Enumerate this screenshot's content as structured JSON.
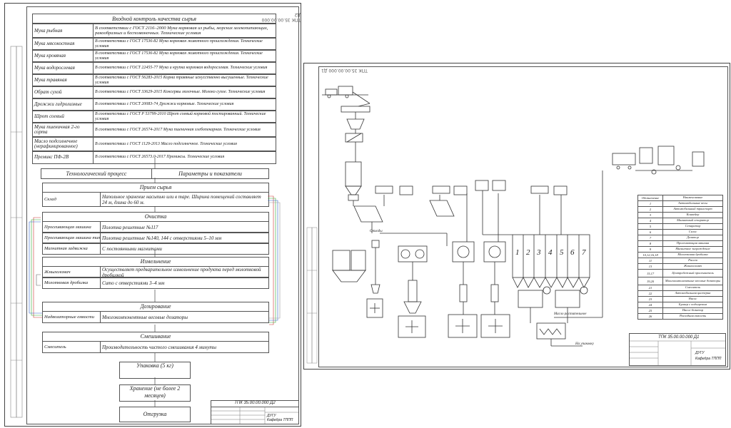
{
  "left_sheet": {
    "stamp": "ТПК 35.00.00.000 Д2",
    "quality_table": {
      "title": "Входной контроль качества сырья",
      "rows": [
        {
          "name": "Мука рыбная",
          "desc": "В соответствии с ГОСТ 2116–2000 Мука кормовая из рыбы, морских млекопитающих, ракообразных и беспозвоночных. Технические условия"
        },
        {
          "name": "Мука мясокостная",
          "desc": "В соответствии с ГОСТ 17536-82 Мука кормовая животного происхождения. Технические условия"
        },
        {
          "name": "Мука кровяная",
          "desc": "В соответствии с ГОСТ 17536-82 Мука кормовая животного происхождения. Технические условия"
        },
        {
          "name": "Мука водорослевая",
          "desc": "В соответствии с ГОСТ 22455-77 Мука и крупка кормовая водорослевая. Технические условия"
        },
        {
          "name": "Мука травяная",
          "desc": "В соответствии с ГОСТ 56283-2015 Корма травяные искусственно высушенные. Технические условия"
        },
        {
          "name": "Обрат сухой",
          "desc": "В соответствии с ГОСТ 33629-2015 Консервы молочные. Молоко сухое. Технические условия"
        },
        {
          "name": "Дрожжи гидролизные",
          "desc": "В соответствии с ГОСТ 20083-74 Дрожжи кормовые. Технические условия"
        },
        {
          "name": "Шрот соевый",
          "desc": "В соответствии с ГОСТ Р 53799-2010 Шрот соевый кормовой тостированный. Технические условия"
        },
        {
          "name": "Мука пшеничная 2-го сорта",
          "desc": "В соответствии с ГОСТ 26574-2017 Мука пшеничная хлебопекарная. Технические условия"
        },
        {
          "name": "Масло подсолнечное (нерафинированное)",
          "desc": "В соответствии с ГОСТ 1129-2013 Масло подсолнечное. Технические условия"
        },
        {
          "name": "Премикс ПФ-2В",
          "desc": "В соответствии с ГОСТ 26573.0-2017 Премиксы. Технические условия"
        }
      ]
    },
    "process_header": {
      "col1": "Технологический процесс",
      "col2": "Параметры и показатели"
    },
    "stages": [
      {
        "title": "Прием сырья",
        "rows": [
          {
            "name": "Склад",
            "desc": "Напольное хранение насыпью или в таре. Ширина помещений составляет 24 м, длина до 60 м."
          }
        ]
      },
      {
        "title": "Очистка",
        "rows": [
          {
            "name": "Просеивающая машина",
            "desc": "Полотна решетные №117"
          },
          {
            "name": "Просеивающая машина типа А1-БЦП",
            "desc": "Полотна решетные №140, 144 с отверстиями 5–10 мм"
          },
          {
            "name": "Магнитная задвижка",
            "desc": "С постоянными магнитами"
          }
        ]
      },
      {
        "title": "Измельчение",
        "rows": [
          {
            "name": "Жмыхоломач",
            "desc": "Осуществляет предварительное измельчение продукта перед молотковой дробилкой"
          },
          {
            "name": "Молотковая дробилка",
            "desc": "Сито с отверстиями 3–4 мм"
          }
        ]
      },
      {
        "title": "Дозирование",
        "rows": [
          {
            "name": "Надвозаторные емкости",
            "desc": "Многокомпонентные весовые дозаторы"
          }
        ]
      },
      {
        "title": "Смешивание",
        "rows": [
          {
            "name": "Смеситель",
            "desc": "Производительность чистого смешивания 4 минуты"
          }
        ]
      }
    ],
    "final_steps": [
      "Упаковка (5 кг)",
      "Хранение (не более 2 месяцев)",
      "Отгрузка"
    ],
    "title_block": {
      "code": "ТПК 35.00.00.000 Д2",
      "org": "Кафедра ТППП",
      "lit": "ДУГУ"
    }
  },
  "right_sheet": {
    "stamp": "ТПК 35.00.00.000 Д1",
    "title_block": {
      "code": "ТПК 35.00.00.000 Д1",
      "org": "Кафедра ТППП",
      "lit": "ДУГУ"
    },
    "bins": [
      "1",
      "2",
      "3",
      "4",
      "5",
      "6",
      "7"
    ],
    "flow_labels": {
      "waste": "Отходы",
      "oil": "Масло растительное",
      "to_packing": "На упаковку"
    },
    "legend": {
      "col1": "Обозначение",
      "col2": "Наименование",
      "rows": [
        {
          "id": "1",
          "name": "Автомобильные весы"
        },
        {
          "id": "2",
          "name": "Автомобильный транспорт"
        },
        {
          "id": "3",
          "name": "Конвейер"
        },
        {
          "id": "4",
          "name": "Магнитный сепаратор"
        },
        {
          "id": "5",
          "name": "Сепаратор"
        },
        {
          "id": "6",
          "name": "Силос"
        },
        {
          "id": "7",
          "name": "Дозатор"
        },
        {
          "id": "8",
          "name": "Просеивающая машина"
        },
        {
          "id": "9",
          "name": "Магнитное заграждение"
        },
        {
          "id": "10,12,16,18",
          "name": "Молотковая дробилка"
        },
        {
          "id": "11",
          "name": "Рассев"
        },
        {
          "id": "13",
          "name": "Жмыхоломач"
        },
        {
          "id": "15,17",
          "name": "Центробежный просеиватель"
        },
        {
          "id": "19,20",
          "name": "Многокомпонентные весовые дозаторы"
        },
        {
          "id": "21",
          "name": "Смеситель"
        },
        {
          "id": "22",
          "name": "Автомобильная цистерна"
        },
        {
          "id": "23",
          "name": "Насос"
        },
        {
          "id": "24",
          "name": "Бункер с подогревом"
        },
        {
          "id": "25",
          "name": "Насос-дозатор"
        },
        {
          "id": "26",
          "name": "Расходная емкость"
        }
      ]
    }
  }
}
